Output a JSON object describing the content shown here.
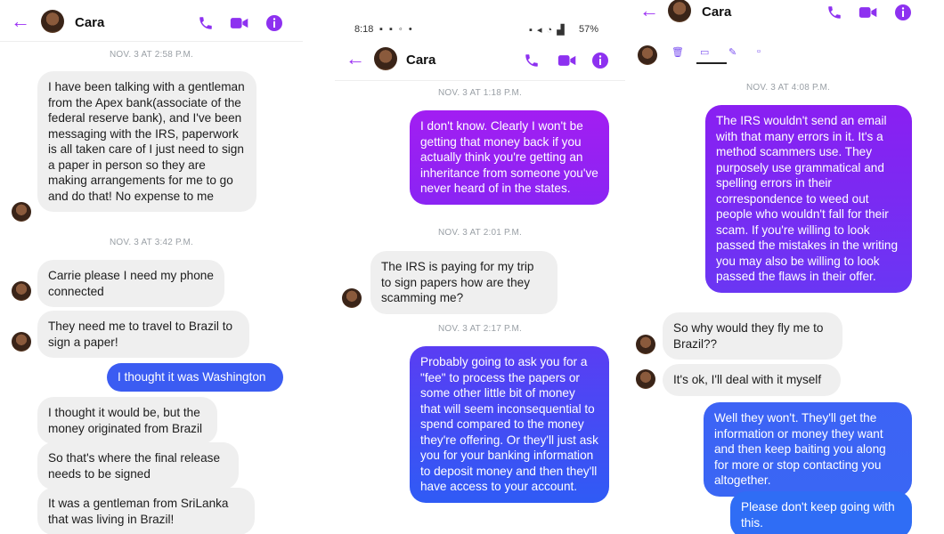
{
  "contact": {
    "name": "Cara"
  },
  "panel1": {
    "timestamps": [
      "NOV. 3 AT 2:58 P.M.",
      "NOV. 3 AT 3:42 P.M."
    ],
    "messages": [
      "I have been talking with a gentleman from the Apex bank(associate of the federal reserve bank), and I've been messaging with the IRS, paperwork is all taken care of I just need to sign a paper in person so they are making arrangements for me to go and do that! No expense to me",
      "Carrie please I need my phone connected",
      "They need me to travel to Brazil to sign a paper!",
      "I thought it was Washington",
      "I thought it would be, but the money originated from Brazil",
      "So that's where the final release needs to be signed",
      "It was a gentleman from SriLanka that was living in Brazil!"
    ]
  },
  "panel2": {
    "status_bar": {
      "time": "8:18",
      "battery": "57%"
    },
    "timestamps": [
      "NOV. 3 AT 1:18 P.M.",
      "NOV. 3 AT 2:01 P.M.",
      "NOV. 3 AT 2:17 P.M."
    ],
    "messages": [
      "I don't know. Clearly I won't be getting that money back if you actually think you're getting an inheritance from someone you've never heard of in the states.",
      "The IRS is paying for my trip to sign papers how are they scamming me?",
      "Probably going to ask you for a \"fee\" to process the papers or some other little bit of money that will seem inconsequential to spend compared to the money they're offering. Or they'll just ask you for your banking information to deposit money and then they'll have access to your account."
    ]
  },
  "panel3": {
    "timestamps": [
      "NOV. 3 AT 4:08 P.M."
    ],
    "messages": [
      "The IRS wouldn't send an email with that many errors in it. It's a method scammers use. They purposely use grammatical and spelling errors in their correspondence to weed out people who wouldn't fall for their scam. If you're willing to look passed the mistakes in the writing you may also be willing to look passed the flaws in their offer.",
      "So why would they fly me to Brazil??",
      "It's ok, I'll deal with it myself",
      "Well they won't. They'll get the information or money they want and then keep baiting you along for more or stop contacting you altogether.",
      "Please don't keep going with this."
    ]
  },
  "icons": [
    "back-arrow-icon",
    "phone-icon",
    "video-icon",
    "info-icon",
    "trash-icon",
    "folder-icon",
    "edit-icon",
    "note-icon"
  ],
  "colors": {
    "accent": "#8d31f0",
    "incoming_bubble": "#efefef",
    "outgoing_purple": "#8a1ff2",
    "outgoing_blue": "#3565f5",
    "timestamp": "#9aa0a6"
  }
}
